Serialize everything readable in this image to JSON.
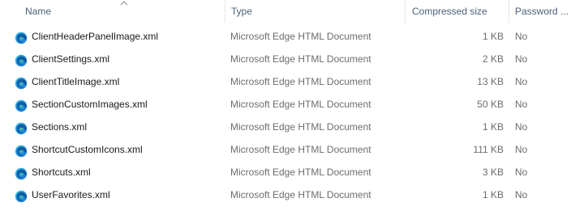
{
  "columns": {
    "name": "Name",
    "type": "Type",
    "compressed_size": "Compressed size",
    "password": "Password ..."
  },
  "sort_icon": "chevron-up-icon",
  "file_icon": "edge-html-icon",
  "files": [
    {
      "name": "ClientHeaderPanelImage.xml",
      "type": "Microsoft Edge HTML Document",
      "size": "1 KB",
      "password": "No"
    },
    {
      "name": "ClientSettings.xml",
      "type": "Microsoft Edge HTML Document",
      "size": "2 KB",
      "password": "No"
    },
    {
      "name": "ClientTitleImage.xml",
      "type": "Microsoft Edge HTML Document",
      "size": "13 KB",
      "password": "No"
    },
    {
      "name": "SectionCustomImages.xml",
      "type": "Microsoft Edge HTML Document",
      "size": "50 KB",
      "password": "No"
    },
    {
      "name": "Sections.xml",
      "type": "Microsoft Edge HTML Document",
      "size": "1 KB",
      "password": "No"
    },
    {
      "name": "ShortcutCustomIcons.xml",
      "type": "Microsoft Edge HTML Document",
      "size": "111 KB",
      "password": "No"
    },
    {
      "name": "Shortcuts.xml",
      "type": "Microsoft Edge HTML Document",
      "size": "3 KB",
      "password": "No"
    },
    {
      "name": "UserFavorites.xml",
      "type": "Microsoft Edge HTML Document",
      "size": "1 KB",
      "password": "No"
    }
  ]
}
